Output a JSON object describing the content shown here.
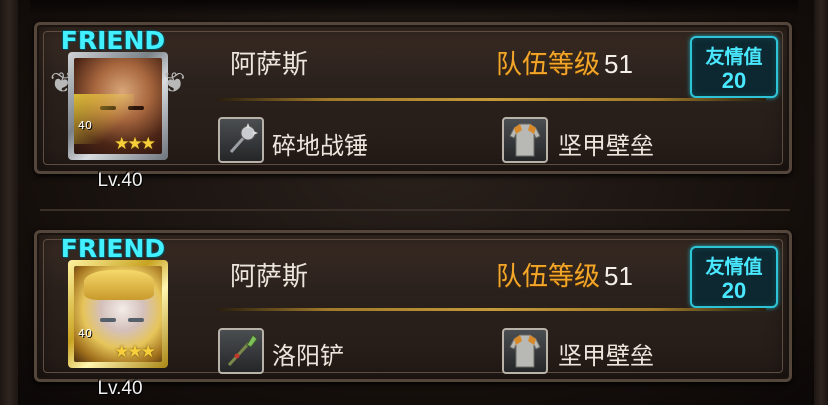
{
  "friends": [
    {
      "tag": "FRIEND",
      "name": "阿萨斯",
      "level_text": "Lv.40",
      "badge_level": "40",
      "stars": "★★★",
      "team_level_label": "队伍等级",
      "team_level_value": "51",
      "friendship_label": "友情值",
      "friendship_value": "20",
      "weapon": {
        "name": "碎地战锤",
        "icon": "hammer-icon"
      },
      "armor": {
        "name": "坚甲壁垒",
        "icon": "chainmail-armor-icon"
      },
      "portrait": "bald-warrior",
      "frame_color": "#aeb4b8"
    },
    {
      "tag": "FRIEND",
      "name": "阿萨斯",
      "level_text": "Lv.40",
      "badge_level": "40",
      "stars": "★★★",
      "team_level_label": "队伍等级",
      "team_level_value": "51",
      "friendship_label": "友情值",
      "friendship_value": "20",
      "weapon": {
        "name": "洛阳铲",
        "icon": "spade-icon"
      },
      "armor": {
        "name": "坚甲壁垒",
        "icon": "chainmail-armor-icon"
      },
      "portrait": "blond-warrior",
      "frame_color": "#e2c43a"
    }
  ],
  "colors": {
    "friend_tag": "#43f0ff",
    "team_level": "#f2a62a",
    "friendship": "#49e8ff"
  }
}
